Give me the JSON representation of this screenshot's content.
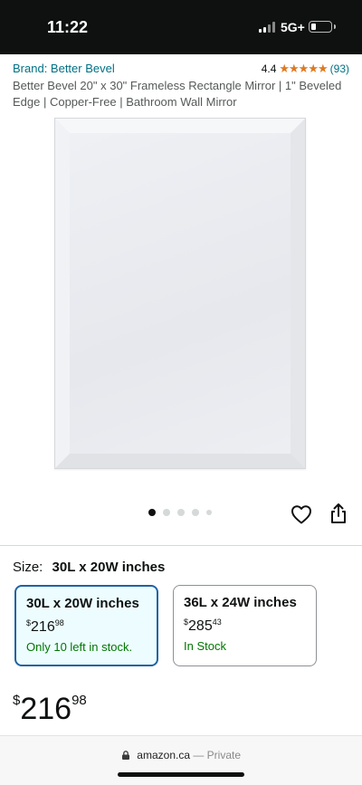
{
  "status_bar": {
    "time": "11:22",
    "network": "5G+",
    "battery_level": 0.2
  },
  "product": {
    "brand": "Brand: Better Bevel",
    "rating": "4.4",
    "rating_stars": 4.4,
    "stars_glyphs": "★★★★★",
    "review_count": "(93)",
    "title": "Better Bevel 20\" x 30\" Frameless Rectangle Mirror | 1\" Beveled Edge | Copper-Free | Bathroom Wall Mirror"
  },
  "gallery": {
    "image_count": 5,
    "active_index": 0
  },
  "size": {
    "label": "Size:",
    "selected": "30L x 20W inches",
    "options": [
      {
        "label": "30L x 20W inches",
        "currency": "$",
        "dollars": "216",
        "cents": "98",
        "stock": "Only 10 left in stock.",
        "selected": true
      },
      {
        "label": "36L x 24W inches",
        "currency": "$",
        "dollars": "285",
        "cents": "43",
        "stock": "In Stock",
        "selected": false
      }
    ]
  },
  "price": {
    "currency": "$",
    "dollars": "216",
    "cents": "98"
  },
  "browser": {
    "domain": "amazon.ca",
    "mode": "— Private"
  },
  "colors": {
    "link": "#007185",
    "star": "#de7921",
    "in_stock": "#007600",
    "selected_border": "#2162a1",
    "selected_bg": "#edfdff"
  },
  "icons": {
    "heart": "heart-icon",
    "share": "share-icon",
    "lock": "lock-icon"
  }
}
